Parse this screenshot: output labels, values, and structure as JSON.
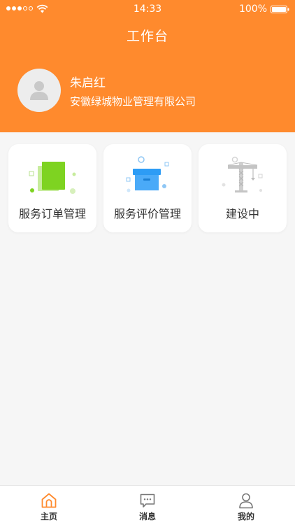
{
  "status_bar": {
    "time": "14:33",
    "battery": "100%",
    "signal_icon": "signal-dots-icon",
    "wifi_icon": "wifi-icon",
    "battery_icon": "battery-full-icon"
  },
  "header": {
    "title": "工作台",
    "background_color": "#ff8a2d",
    "avatar_icon": "avatar-placeholder-icon",
    "user_name": "朱启红",
    "company": "安徽绿城物业管理有限公司"
  },
  "cards": [
    {
      "label": "服务订单管理",
      "icon": "document-stack-icon",
      "accent": "#7ed321"
    },
    {
      "label": "服务评价管理",
      "icon": "archive-box-icon",
      "accent": "#2d9cf5"
    },
    {
      "label": "建设中",
      "icon": "construction-crane-icon",
      "accent": "#cccccc"
    }
  ],
  "tab_bar": {
    "items": [
      {
        "label": "主页",
        "icon": "home-icon",
        "active": true
      },
      {
        "label": "消息",
        "icon": "message-icon",
        "active": false
      },
      {
        "label": "我的",
        "icon": "user-icon",
        "active": false
      }
    ],
    "active_color": "#ff8a2d"
  }
}
